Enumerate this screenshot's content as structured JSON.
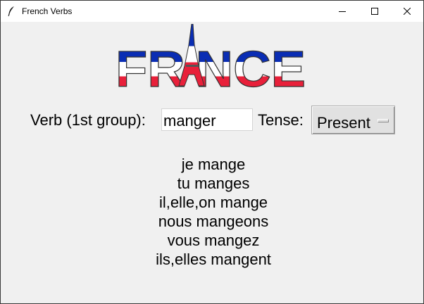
{
  "window": {
    "title": "French Verbs",
    "app_icon": "feather-icon",
    "controls": [
      "minimize-icon",
      "maximize-icon",
      "close-icon"
    ]
  },
  "logo": {
    "text": "FRANCE",
    "icon": "eiffel-tower-icon",
    "colors": {
      "blue": "#0a2db4",
      "white": "#ffffff",
      "red": "#e8203a"
    }
  },
  "form": {
    "verb_label": "Verb (1st group):",
    "verb_value": "manger",
    "tense_label": "Tense:",
    "tense_value": "Present"
  },
  "conjugations": [
    "je mange",
    "tu manges",
    "il,elle,on mange",
    "nous mangeons",
    "vous mangez",
    "ils,elles mangent"
  ]
}
